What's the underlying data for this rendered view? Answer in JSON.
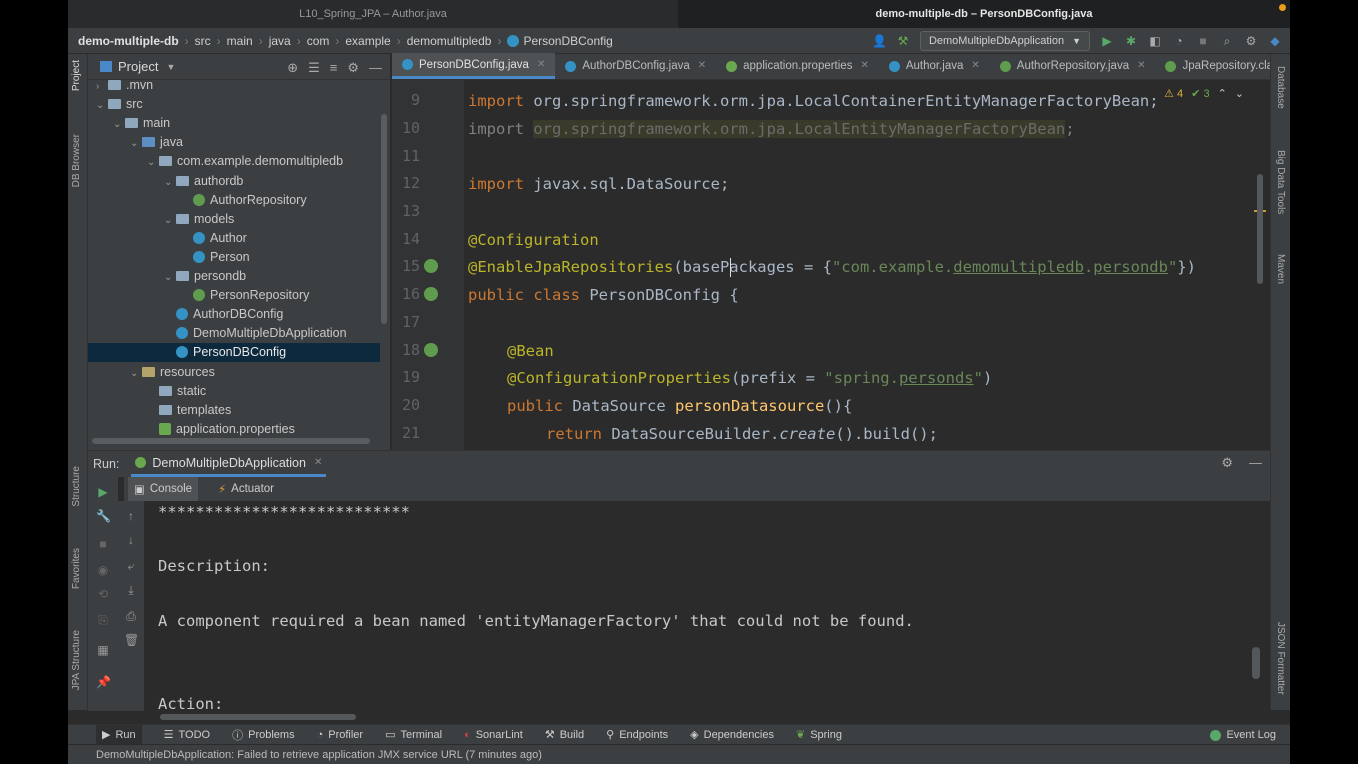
{
  "window": {
    "title_left": "L10_Spring_JPA – Author.java",
    "title_right": "demo-multiple-db – PersonDBConfig.java"
  },
  "breadcrumb": [
    "demo-multiple-db",
    "src",
    "main",
    "java",
    "com",
    "example",
    "demomultipledb",
    "PersonDBConfig"
  ],
  "run_config": "DemoMultipleDbApplication",
  "left_strip": {
    "project": "Project",
    "db_browser": "DB Browser",
    "structure": "Structure",
    "favorites": "Favorites",
    "jpa_structure": "JPA Structure"
  },
  "right_strip": {
    "database": "Database",
    "big_data": "Big Data Tools",
    "maven": "Maven",
    "json": "JSON Formatter"
  },
  "project_panel": {
    "title": "Project",
    "tree": [
      {
        "label": ".mvn",
        "indent": 0,
        "kind": "folder",
        "arrow": ">"
      },
      {
        "label": "src",
        "indent": 0,
        "kind": "folder",
        "arrow": "v"
      },
      {
        "label": "main",
        "indent": 1,
        "kind": "folder",
        "arrow": "v"
      },
      {
        "label": "java",
        "indent": 2,
        "kind": "src",
        "arrow": "v"
      },
      {
        "label": "com.example.demomultipledb",
        "indent": 3,
        "kind": "folder",
        "arrow": "v"
      },
      {
        "label": "authordb",
        "indent": 4,
        "kind": "folder",
        "arrow": "v"
      },
      {
        "label": "AuthorRepository",
        "indent": 5,
        "kind": "interface",
        "arrow": ""
      },
      {
        "label": "models",
        "indent": 4,
        "kind": "folder",
        "arrow": "v"
      },
      {
        "label": "Author",
        "indent": 5,
        "kind": "class",
        "arrow": ""
      },
      {
        "label": "Person",
        "indent": 5,
        "kind": "class",
        "arrow": ""
      },
      {
        "label": "persondb",
        "indent": 4,
        "kind": "folder",
        "arrow": "v"
      },
      {
        "label": "PersonRepository",
        "indent": 5,
        "kind": "interface",
        "arrow": ""
      },
      {
        "label": "AuthorDBConfig",
        "indent": 4,
        "kind": "class",
        "arrow": ""
      },
      {
        "label": "DemoMultipleDbApplication",
        "indent": 4,
        "kind": "class",
        "arrow": ""
      },
      {
        "label": "PersonDBConfig",
        "indent": 4,
        "kind": "class",
        "arrow": "",
        "selected": true
      },
      {
        "label": "resources",
        "indent": 2,
        "kind": "res",
        "arrow": "v"
      },
      {
        "label": "static",
        "indent": 3,
        "kind": "folder",
        "arrow": ""
      },
      {
        "label": "templates",
        "indent": 3,
        "kind": "folder",
        "arrow": ""
      },
      {
        "label": "application.properties",
        "indent": 3,
        "kind": "spring",
        "arrow": ""
      }
    ]
  },
  "editor": {
    "tabs": [
      {
        "label": "PersonDBConfig.java",
        "active": true,
        "color": "#3592c4"
      },
      {
        "label": "AuthorDBConfig.java",
        "active": false,
        "color": "#3592c4"
      },
      {
        "label": "application.properties",
        "active": false,
        "color": "#6aa84f"
      },
      {
        "label": "Author.java",
        "active": false,
        "color": "#3592c4"
      },
      {
        "label": "AuthorRepository.java",
        "active": false,
        "color": "#5f9c4e"
      },
      {
        "label": "JpaRepository.class",
        "active": false,
        "color": "#5f9c4e"
      }
    ],
    "warnings": "⚠ 4",
    "checks": "✔ 3",
    "line_numbers": [
      "9",
      "10",
      "11",
      "12",
      "13",
      "14",
      "15",
      "16",
      "17",
      "18",
      "19",
      "20",
      "21"
    ],
    "code": {
      "l9_kw": "import",
      "l9_rest": " org.springframework.orm.jpa.LocalContainerEntityManagerFactoryBean;",
      "l10_kw": "import",
      "l10_rest": "org.springframework.orm.jpa.LocalEntityManagerFactoryBean",
      "l10_semi": ";",
      "l12_kw": "import",
      "l12_rest": " javax.sql.DataSource;",
      "l14": "@Configuration",
      "l15_an": "@EnableJpaRepositories",
      "l15_a": "(basePackages = {",
      "l15_s1": "\"com.example.",
      "l15_s2": "demomultipledb",
      "l15_s3": ".",
      "l15_s4": "persondb",
      "l15_s5": "\"",
      "l15_b": "})",
      "l16_kw1": "public",
      "l16_kw2": "class",
      "l16_rest": " PersonDBConfig {",
      "l18": "@Bean",
      "l19_an": "@ConfigurationProperties",
      "l19_a": "(prefix = ",
      "l19_s1": "\"spring.",
      "l19_s2": "personds",
      "l19_s3": "\"",
      "l19_b": ")",
      "l20_kw": "public",
      "l20_a": " DataSource ",
      "l20_fn": "personDatasource",
      "l20_b": "(){",
      "l21_kw": "return",
      "l21_a": " DataSourceBuilder.",
      "l21_it": "create",
      "l21_b": "().build();"
    }
  },
  "run_panel": {
    "label": "Run:",
    "tab": "DemoMultipleDbApplication",
    "subtabs": {
      "console": "Console",
      "actuator": "Actuator"
    },
    "console_lines": [
      "***************************",
      "",
      "Description:",
      "",
      "A component required a bean named 'entityManagerFactory' that could not be found.",
      "",
      "",
      "Action:"
    ]
  },
  "bottom_toolbar": [
    "Run",
    "TODO",
    "Problems",
    "Profiler",
    "Terminal",
    "SonarLint",
    "Build",
    "Endpoints",
    "Dependencies",
    "Spring"
  ],
  "event_log": "Event Log",
  "status": "DemoMultipleDbApplication: Failed to retrieve application JMX service URL (7 minutes ago)",
  "colors": {
    "accent": "#4a88c7",
    "selection": "#0d293e",
    "keyword": "#cc7832",
    "annotation": "#bbb529",
    "string": "#6a8759"
  }
}
